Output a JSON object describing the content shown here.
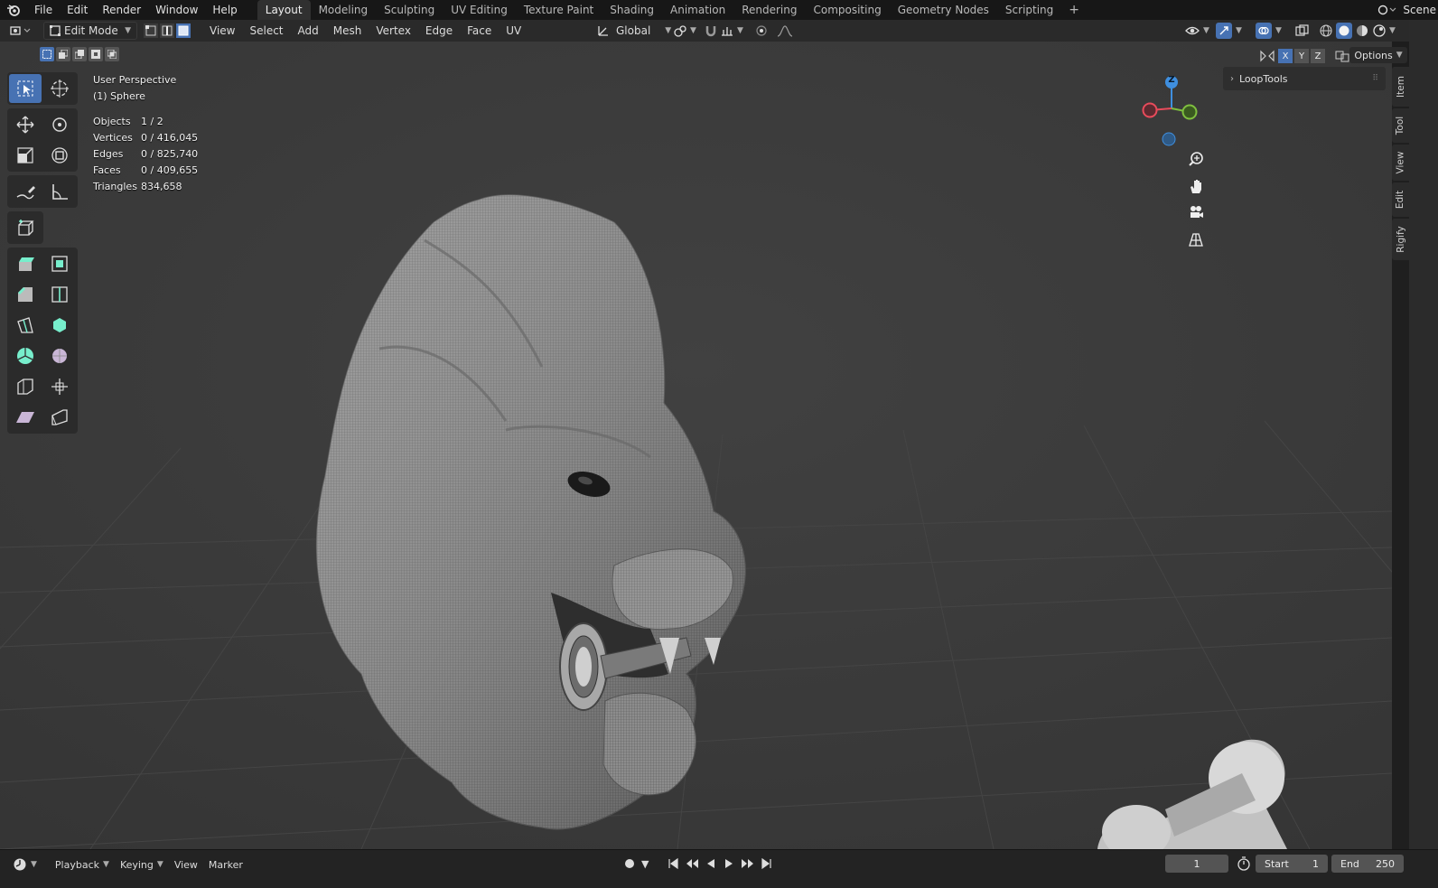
{
  "topbar": {
    "menus": [
      "File",
      "Edit",
      "Render",
      "Window",
      "Help"
    ],
    "workspaces": [
      "Layout",
      "Modeling",
      "Sculpting",
      "UV Editing",
      "Texture Paint",
      "Shading",
      "Animation",
      "Rendering",
      "Compositing",
      "Geometry Nodes",
      "Scripting"
    ],
    "active_workspace": "Layout",
    "add_tab": "+",
    "scene_label": "Scene"
  },
  "header": {
    "mode": "Edit Mode",
    "menus": [
      "View",
      "Select",
      "Add",
      "Mesh",
      "Vertex",
      "Edge",
      "Face",
      "UV"
    ],
    "transform_orientation": "Global",
    "options_label": "Options",
    "axes": [
      "X",
      "Y",
      "Z"
    ]
  },
  "overlay": {
    "view_name": "User Perspective",
    "object_name": "(1) Sphere",
    "stats": [
      {
        "key": "Objects",
        "value": "1 / 2"
      },
      {
        "key": "Vertices",
        "value": "0 / 416,045"
      },
      {
        "key": "Edges",
        "value": "0 / 825,740"
      },
      {
        "key": "Faces",
        "value": "0 / 409,655"
      },
      {
        "key": "Triangles",
        "value": "834,658"
      }
    ]
  },
  "gizmo": {
    "z_label": "Z"
  },
  "npanel": {
    "panel_title": "LoopTools",
    "tabs": [
      "Item",
      "Tool",
      "View",
      "Edit",
      "Rigify"
    ]
  },
  "timeline": {
    "menus": [
      "Playback",
      "Keying",
      "View",
      "Marker"
    ],
    "current_frame": "1",
    "start_label": "Start",
    "start_value": "1",
    "end_label": "End",
    "end_value": "250"
  },
  "colors": {
    "accent": "#4772b3",
    "viewport_bg": "#3b3b3b",
    "axis_x": "#e84b5b",
    "axis_y": "#7fbf3f",
    "axis_z": "#3f8fdf"
  }
}
